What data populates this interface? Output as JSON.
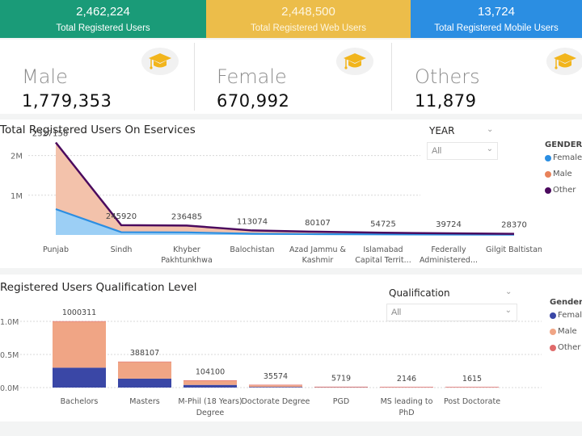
{
  "kpis": [
    {
      "value": "2,462,224",
      "label": "Total Registered Users",
      "color": "#1a9b78"
    },
    {
      "value": "2,448,500",
      "label": "Total Registered Web Users",
      "color": "#ecbd4a"
    },
    {
      "value": "13,724",
      "label": "Total Registered Mobile Users",
      "color": "#2b8ee2"
    }
  ],
  "gender_cards": [
    {
      "label": "Male",
      "value": "1,779,353",
      "icon": "graduation-cap-icon"
    },
    {
      "label": "Female",
      "value": "670,992",
      "icon": "graduation-cap-icon"
    },
    {
      "label": "Others",
      "value": "11,879",
      "icon": "graduation-cap-icon"
    }
  ],
  "eservices": {
    "title": "Total Registered Users On Eservices",
    "slicer": {
      "label": "YEAR",
      "value": "All"
    },
    "legend_title": "GENDER",
    "legend": [
      {
        "name": "Female",
        "color": "#2b8ee2"
      },
      {
        "name": "Male",
        "color": "#e8825a"
      },
      {
        "name": "Other",
        "color": "#4b0a5e"
      }
    ]
  },
  "qualification": {
    "title": "Registered Users Qualification Level",
    "slicer": {
      "label": "Qualification",
      "value": "All"
    },
    "legend_title": "Gender",
    "legend": [
      {
        "name": "Female",
        "color": "#3a47a6"
      },
      {
        "name": "Male",
        "color": "#f0a585"
      },
      {
        "name": "Other",
        "color": "#e06a6a"
      }
    ]
  },
  "chart_data": [
    {
      "type": "area",
      "title": "Total Registered Users On Eservices",
      "xlabel": "",
      "ylabel": "",
      "categories": [
        "Punjab",
        "Sindh",
        "Khyber Pakhtunkhwa",
        "Balochistan",
        "Azad Jammu & Kashmir",
        "Islamabad Capital Territ...",
        "Federally Administered...",
        "Gilgit Baltistan"
      ],
      "category_lines": [
        [
          "Punjab"
        ],
        [
          "Sindh"
        ],
        [
          "Khyber",
          "Pakhtunkhwa"
        ],
        [
          "Balochistan"
        ],
        [
          "Azad Jammu &",
          "Kashmir"
        ],
        [
          "Islamabad",
          "Capital Territ..."
        ],
        [
          "Federally",
          "Administered..."
        ],
        [
          "Gilgit Baltistan"
        ]
      ],
      "totals": [
        2327158,
        245920,
        236485,
        113074,
        80107,
        54725,
        39724,
        28370
      ],
      "series": [
        {
          "name": "Female",
          "values": [
            650000,
            70000,
            65000,
            30000,
            20000,
            15000,
            10000,
            8000
          ]
        },
        {
          "name": "Male",
          "values": [
            1670000,
            173000,
            169000,
            82000,
            59000,
            39000,
            29000,
            20000
          ]
        },
        {
          "name": "Other",
          "values": [
            7158,
            2920,
            2485,
            1074,
            1107,
            725,
            724,
            370
          ]
        }
      ],
      "yticks": [
        "1M",
        "2M"
      ],
      "ytick_values": [
        1000000,
        2000000
      ],
      "ylim": [
        0,
        2500000
      ],
      "grid": true,
      "legend_position": "right"
    },
    {
      "type": "bar",
      "stacked": true,
      "title": "Registered Users Qualification Level",
      "xlabel": "",
      "ylabel": "",
      "categories": [
        "Bachelors",
        "Masters",
        "M-Phil (18 Years) Degree",
        "Doctorate Degree",
        "PGD",
        "MS leading to PhD",
        "Post Doctorate"
      ],
      "category_lines": [
        [
          "Bachelors"
        ],
        [
          "Masters"
        ],
        [
          "M-Phil (18 Years)",
          "Degree"
        ],
        [
          "Doctorate Degree"
        ],
        [
          "PGD"
        ],
        [
          "MS leading to",
          "PhD"
        ],
        [
          "Post Doctorate"
        ]
      ],
      "totals": [
        1000311,
        388107,
        104100,
        35574,
        5719,
        2146,
        1615
      ],
      "series": [
        {
          "name": "Female",
          "values": [
            300000,
            135000,
            40000,
            10000,
            2000,
            700,
            500
          ]
        },
        {
          "name": "Male",
          "values": [
            695000,
            250000,
            63000,
            25000,
            3600,
            1400,
            1100
          ]
        },
        {
          "name": "Other",
          "values": [
            5311,
            3107,
            1100,
            574,
            119,
            46,
            15
          ]
        }
      ],
      "yticks": [
        "0.0M",
        "0.5M",
        "1.0M"
      ],
      "ytick_values": [
        0,
        500000,
        1000000
      ],
      "ylim": [
        0,
        1000000
      ],
      "grid": true,
      "legend_position": "right"
    }
  ]
}
